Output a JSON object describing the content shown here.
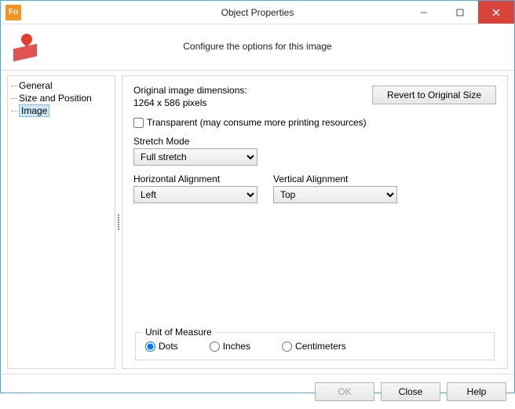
{
  "window": {
    "title": "Object Properties",
    "app_badge": "Fo",
    "subtitle": "Configure the options for this image"
  },
  "tree": {
    "items": [
      "General",
      "Size and Position",
      "Image"
    ],
    "selected_index": 2
  },
  "image_panel": {
    "dimensions_label": "Original image dimensions:",
    "dimensions_value": "1264 x 586 pixels",
    "revert_button": "Revert to Original Size",
    "transparent_label": "Transparent (may consume more printing resources)",
    "transparent_checked": false,
    "stretch": {
      "label": "Stretch Mode",
      "value": "Full stretch"
    },
    "h_align": {
      "label": "Horizontal Alignment",
      "value": "Left"
    },
    "v_align": {
      "label": "Vertical Alignment",
      "value": "Top"
    },
    "unit": {
      "legend": "Unit of Measure",
      "options": [
        "Dots",
        "Inches",
        "Centimeters"
      ],
      "selected": "Dots"
    }
  },
  "footer": {
    "ok": "OK",
    "close": "Close",
    "help": "Help",
    "ok_enabled": false
  }
}
